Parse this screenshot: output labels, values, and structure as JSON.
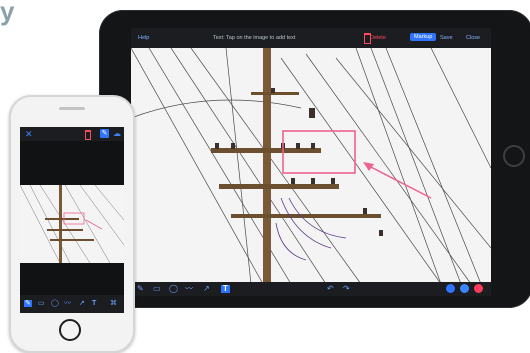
{
  "corner_text": "y",
  "tablet": {
    "toolbar": {
      "help": "Help",
      "hint": "Text: Tap on the image to add text",
      "delete": "Delete",
      "markup": "Markup",
      "save": "Save",
      "close": "Close"
    },
    "bottom_tools": {
      "pen_icon": "✎",
      "rect_icon": "▭",
      "ellipse_icon": "◯",
      "freehand_icon": "〰",
      "arrow_icon": "↗",
      "text_tool": "T",
      "undo_icon": "↶",
      "redo_icon": "↷"
    },
    "annotation": {
      "shape": "rectangle",
      "color": "#f0628f",
      "arrow_color": "#f0628f"
    }
  },
  "phone": {
    "top": {
      "close_icon": "✕",
      "pen_icon": "✎",
      "cloud_icon": "☁"
    },
    "bottom_tools": {
      "pen_icon": "✎",
      "rect_icon": "▭",
      "ellipse_icon": "◯",
      "freehand_icon": "〰",
      "arrow_icon": "↗",
      "text_tool": "T",
      "tag_icon": "⌘"
    }
  },
  "colors": {
    "accent": "#2e74ff",
    "danger": "#ff4b5b",
    "annotation": "#f0628f"
  }
}
